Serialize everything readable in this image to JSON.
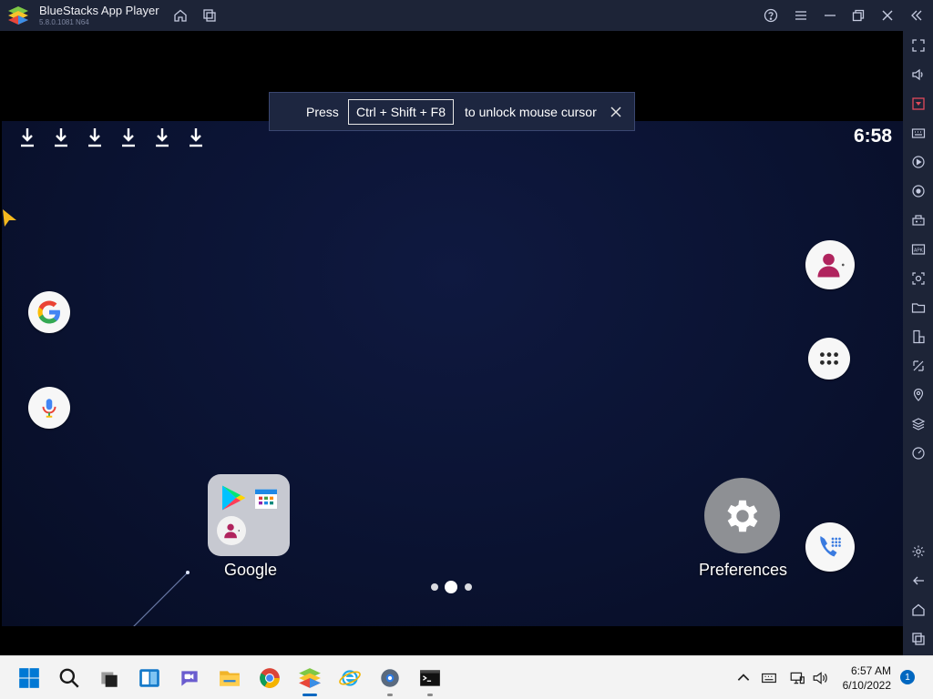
{
  "window": {
    "title": "BlueStacks App Player",
    "version": "5.8.0.1081 N64"
  },
  "toast": {
    "press": "Press",
    "keys": "Ctrl + Shift + F8",
    "rest": "to unlock mouse cursor"
  },
  "status_bar": {
    "time": "6:58",
    "download_icons": [
      "download-icon",
      "download-icon",
      "download-icon",
      "download-icon",
      "download-icon",
      "download-icon"
    ]
  },
  "home": {
    "folder_label": "Google",
    "settings_label": "Preferences",
    "page_indicator": {
      "pages": 3,
      "current": 2
    }
  },
  "taskbar": {
    "time": "6:57 AM",
    "date": "6/10/2022",
    "notification_count": "1"
  },
  "colors": {
    "chrome": "#1d2437",
    "accent": "#0067c0",
    "screen_bg": "#0a1230"
  }
}
